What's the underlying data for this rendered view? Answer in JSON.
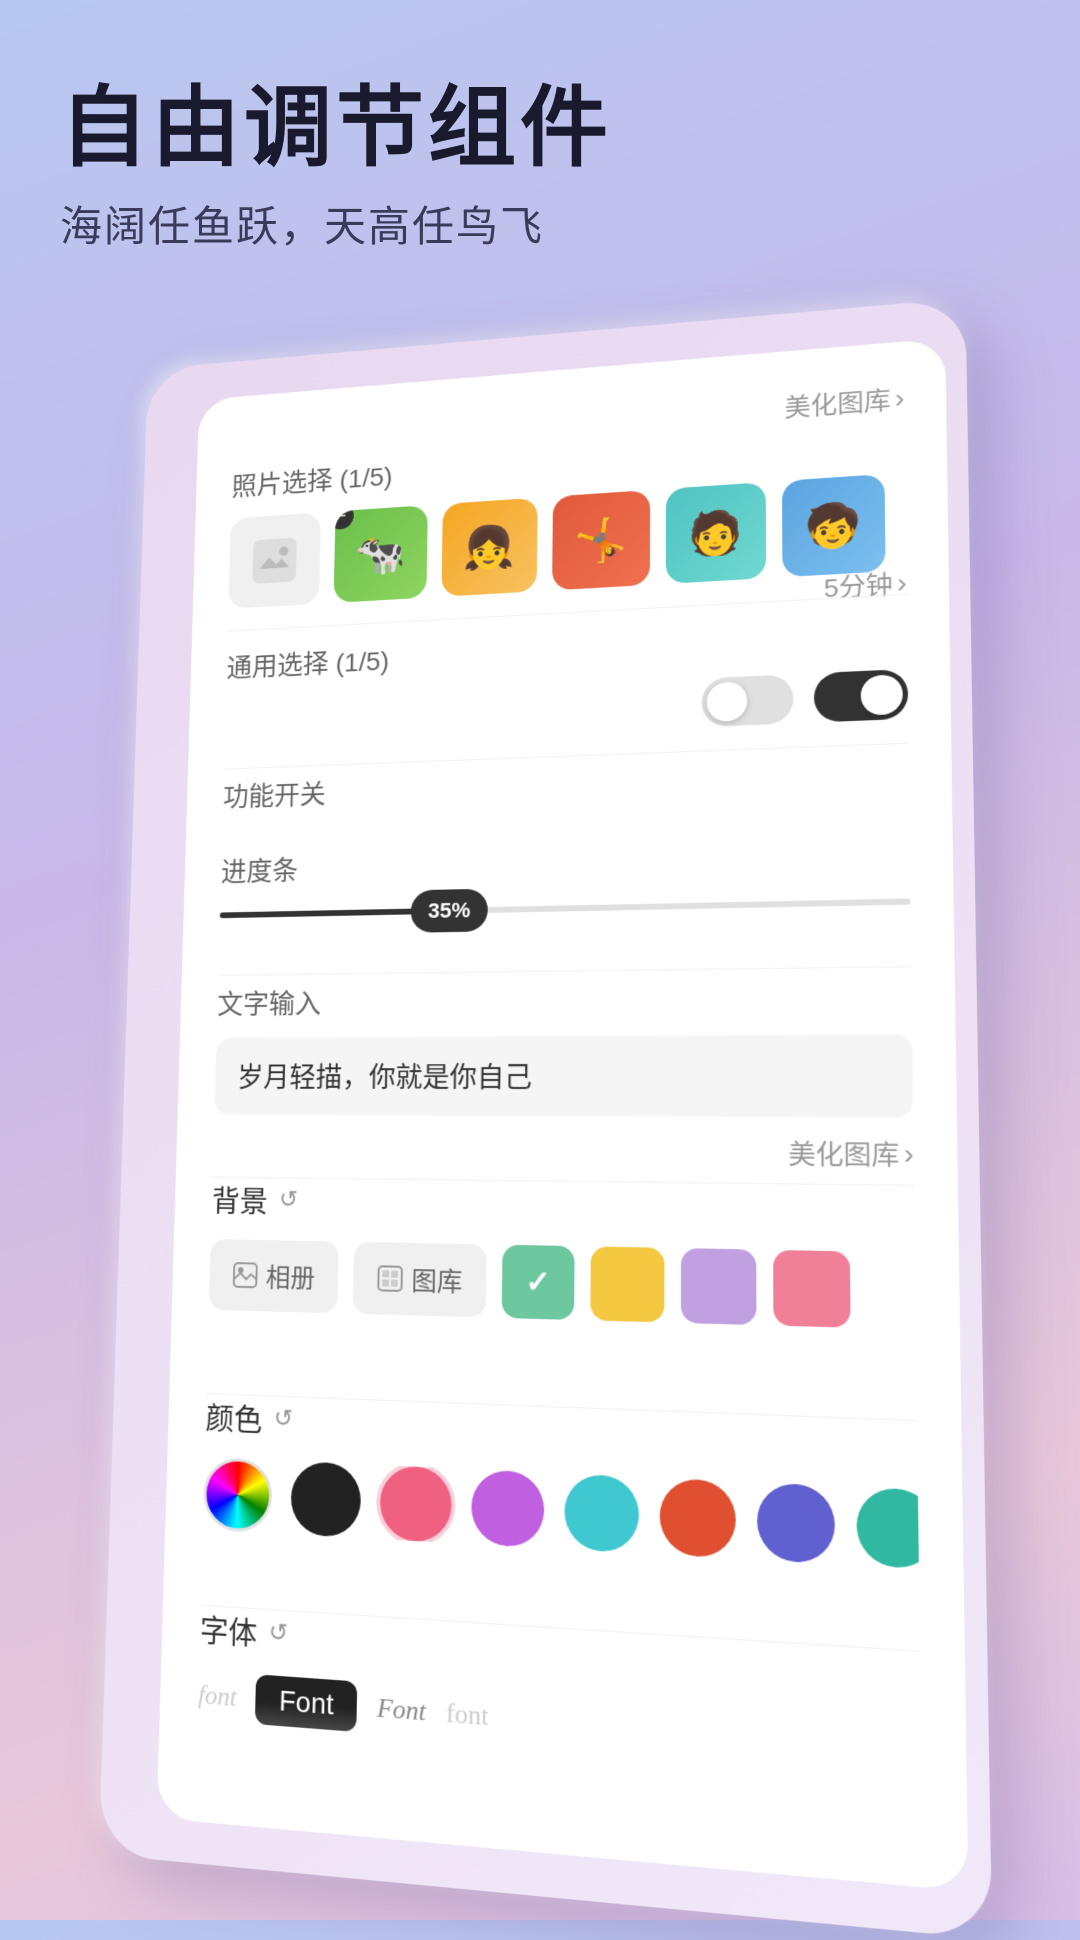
{
  "page": {
    "background": "linear-gradient(160deg, #b8c8f0 0%, #c8b8e8 40%, #e8c8d8 80%, #d8c0e8 100%)"
  },
  "header": {
    "title": "自由调节组件",
    "subtitle": "海阔任鱼跃，天高任鸟飞"
  },
  "card": {
    "meihualibrary_label": "美化图库",
    "photo_section_label": "照片选择 (1/5)",
    "time_label": "5分钟",
    "general_section_label": "通用选择 (1/5)",
    "func_switch_label": "功能开关",
    "progress_label": "进度条",
    "progress_value": "35%",
    "text_input_label": "文字输入",
    "text_input_value": "岁月轻描，你就是你自己",
    "meihualibrary2_label": "美化图库",
    "background_label": "背景",
    "album_btn_label": "相册",
    "gallery_btn_label": "图库",
    "color_label": "颜色",
    "font_label": "字体",
    "font_items": [
      {
        "text": "font",
        "style": "italic_light",
        "color": "gray_light"
      },
      {
        "text": "Font",
        "style": "bold_black",
        "color": "black_bg"
      },
      {
        "text": "Font",
        "style": "italic_serif",
        "color": "medium_gray"
      },
      {
        "text": "font",
        "style": "script",
        "color": "light_gray"
      }
    ]
  }
}
